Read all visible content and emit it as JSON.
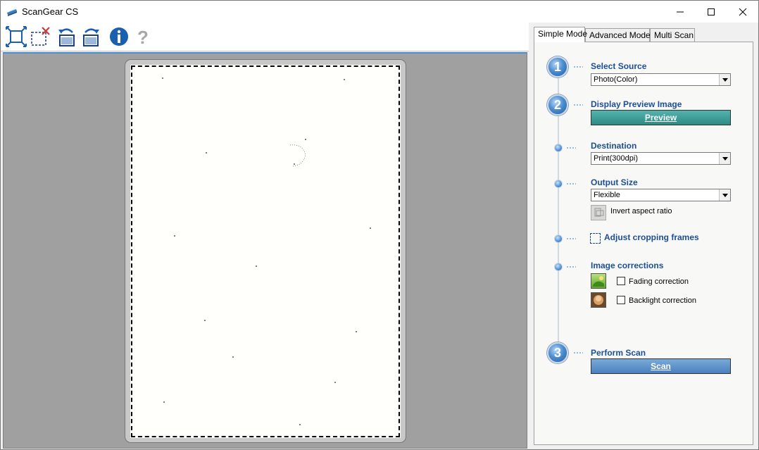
{
  "window": {
    "title": "ScanGear CS"
  },
  "toolbar": {
    "buttons": [
      {
        "icon": "auto-crop-icon"
      },
      {
        "icon": "remove-crop-icon"
      },
      {
        "icon": "rotate-left-icon"
      },
      {
        "icon": "rotate-right-icon"
      },
      {
        "icon": "info-icon"
      },
      {
        "icon": "help-icon"
      }
    ]
  },
  "tabs": [
    "Simple Mode",
    "Advanced Mode",
    "Multi Scan"
  ],
  "panel": {
    "step1": {
      "number": "1",
      "label": "Select Source",
      "value": "Photo(Color)"
    },
    "step2": {
      "number": "2",
      "label": "Display Preview Image",
      "button": "Preview"
    },
    "destination": {
      "label": "Destination",
      "value": "Print(300dpi)"
    },
    "output_size": {
      "label": "Output Size",
      "value": "Flexible",
      "invert_label": "Invert aspect ratio"
    },
    "crop": {
      "label": "Adjust cropping frames"
    },
    "corrections": {
      "label": "Image corrections",
      "fading": "Fading correction",
      "backlight": "Backlight correction"
    },
    "step3": {
      "number": "3",
      "label": "Perform Scan",
      "button": "Scan"
    }
  },
  "colors": {
    "accent_blue": "#1c4f95",
    "preview_button": "#2d8a85",
    "scan_button": "#4a80bd"
  }
}
